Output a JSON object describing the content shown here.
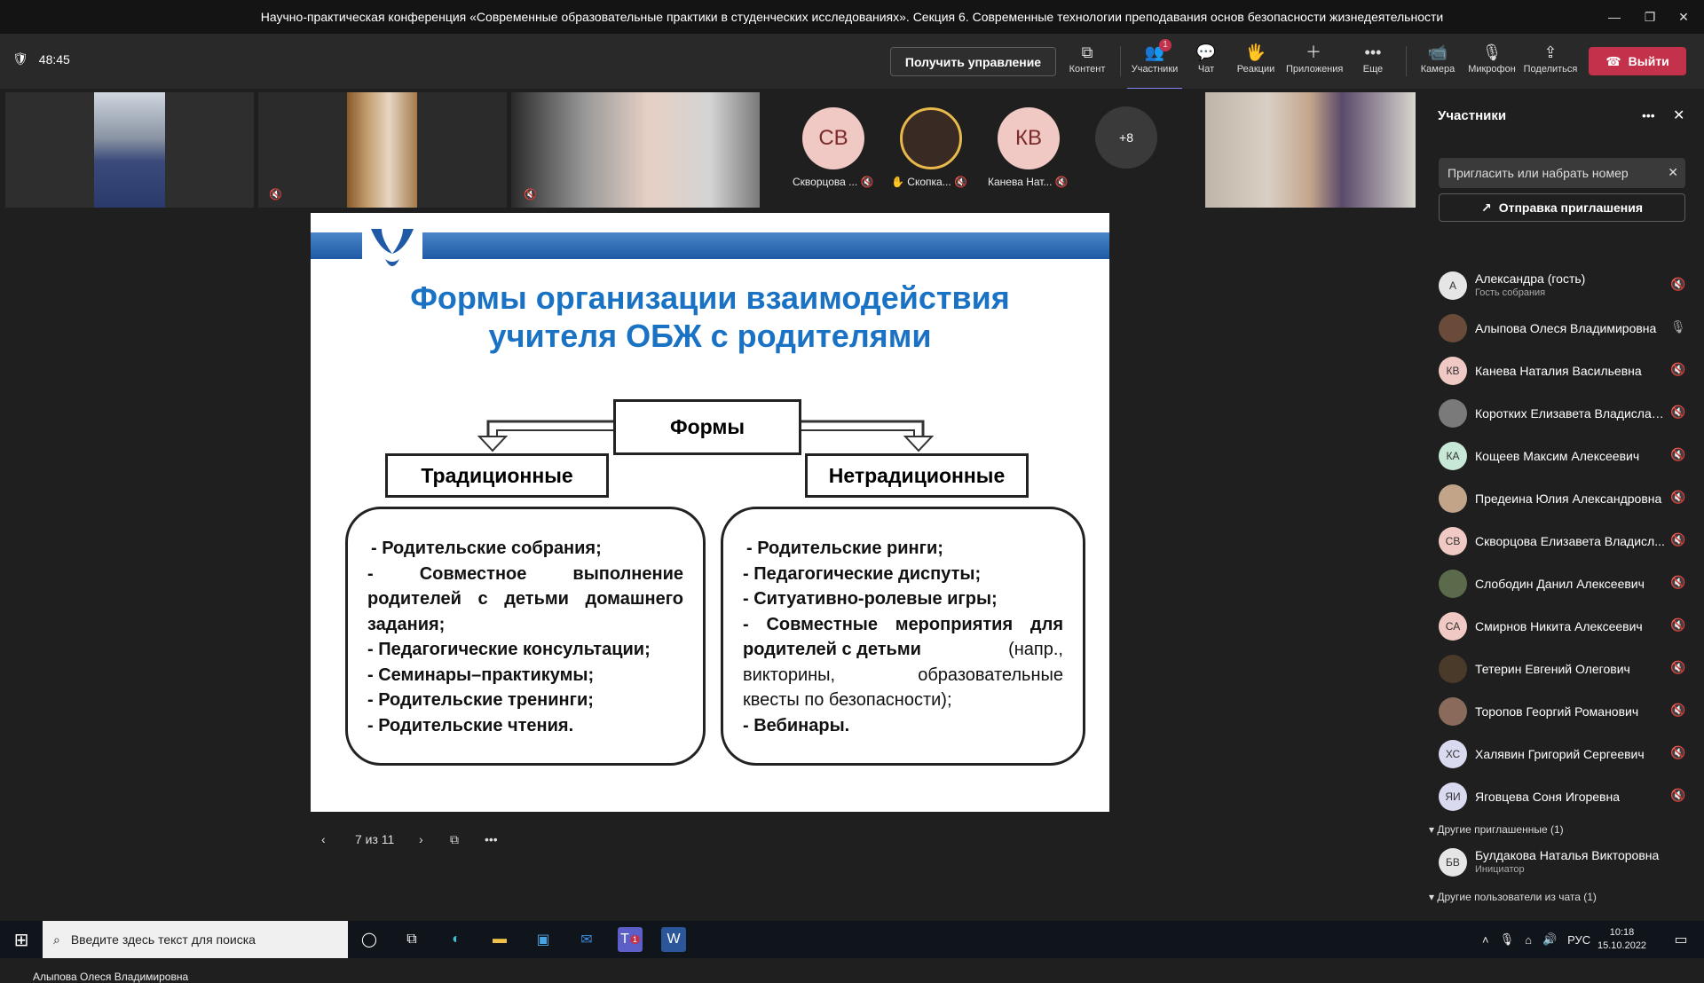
{
  "window": {
    "title": "Научно-практическая конференция «Современные образовательные практики в студенческих исследованиях». Секция 6. Современные технологии преподавания основ безопасности жизнедеятельности",
    "minimize": "—",
    "restore": "❐",
    "close": "✕"
  },
  "toolbar": {
    "timer": "48:45",
    "request_control": "Получить управление",
    "content": "Контент",
    "participants": "Участники",
    "participants_badge": "1",
    "chat": "Чат",
    "reactions": "Реакции",
    "apps": "Приложения",
    "more": "Еще",
    "camera": "Камера",
    "microphone": "Микрофон",
    "share": "Поделиться",
    "leave": "Выйти"
  },
  "gallery": {
    "tiles": [
      {
        "initials": "СВ",
        "label": "Скворцова ...",
        "color": "#f1c9c4"
      },
      {
        "initials": "",
        "label": "Скопка...",
        "color": "#3a2a24"
      },
      {
        "initials": "КВ",
        "label": "Канева Нат...",
        "color": "#f1c9c4"
      }
    ],
    "overflow": "+8",
    "hand_icon": "✋"
  },
  "slide": {
    "title_line1": "Формы организации взаимодействия",
    "title_line2": "учителя ОБЖ с родителями",
    "root": "Формы",
    "left_head": "Традиционные",
    "right_head": "Нетрадиционные",
    "left_items": [
      "- Родительские собрания;",
      "- Совместное выполнение",
      "родителей с детьми домашнего",
      "задания;",
      "- Педагогические консультации;",
      "- Семинары–практикумы;",
      "- Родительские тренинги;",
      "- Родительские чтения."
    ],
    "right_items": [
      "- Родительские ринги;",
      "- Педагогические диспуты;",
      "- Ситуативно-ролевые игры;",
      "- Совместные мероприятия для",
      "родителей с детьми",
      "(напр.,",
      "викторины, образовательные",
      "квесты по безопасности);",
      "- Вебинары."
    ]
  },
  "slide_nav": {
    "counter": "7 из 11"
  },
  "presenter": "Алыпова Олеся Владимировна",
  "panel": {
    "title": "Участники",
    "invite_placeholder": "Пригласить или набрать номер",
    "send_invite": "Отправка приглашения",
    "people": [
      {
        "initials": "А",
        "name": "Александра (гость)",
        "sub": "Гость собрания",
        "color": "#e6e6e6",
        "muted": true
      },
      {
        "initials": "",
        "name": "Алыпова Олеся Владимировна",
        "sub": "",
        "color": "#6a4b3a",
        "muted": false
      },
      {
        "initials": "КВ",
        "name": "Канева Наталия Васильевна",
        "sub": "",
        "color": "#f1c9c4",
        "muted": true
      },
      {
        "initials": "",
        "name": "Коротких Елизавета Владислав...",
        "sub": "",
        "color": "#7a7a7a",
        "muted": true
      },
      {
        "initials": "КА",
        "name": "Кощеев Максим Алексеевич",
        "sub": "",
        "color": "#c7e8d6",
        "muted": true
      },
      {
        "initials": "",
        "name": "Предеина Юлия Александровна",
        "sub": "",
        "color": "#c2a588",
        "muted": true
      },
      {
        "initials": "СВ",
        "name": "Скворцова Елизавета Владисл...",
        "sub": "",
        "color": "#f1c9c4",
        "muted": true
      },
      {
        "initials": "",
        "name": "Слободин Данил Алексеевич",
        "sub": "",
        "color": "#5a6a4a",
        "muted": true
      },
      {
        "initials": "СА",
        "name": "Смирнов Никита Алексеевич",
        "sub": "",
        "color": "#f1c9c4",
        "muted": true
      },
      {
        "initials": "",
        "name": "Тетерин Евгений Олегович",
        "sub": "",
        "color": "#4a3a2a",
        "muted": true
      },
      {
        "initials": "",
        "name": "Торопов Георгий Романович",
        "sub": "",
        "color": "#8a6a5a",
        "muted": true
      },
      {
        "initials": "ХС",
        "name": "Халявин Григорий Сергеевич",
        "sub": "",
        "color": "#d9d9ef",
        "muted": true
      },
      {
        "initials": "ЯИ",
        "name": "Яговцева Соня Игоревна",
        "sub": "",
        "color": "#d9d9ef",
        "muted": true
      }
    ],
    "section_other_invited": "Другие приглашенные (1)",
    "invited": {
      "initials": "БВ",
      "name": "Булдакова Наталья Викторовна",
      "sub": "Инициатор",
      "color": "#e6e6e6"
    },
    "section_chat_users": "Другие пользователи из чата (1)"
  },
  "taskbar": {
    "search_placeholder": "Введите здесь текст для поиска",
    "teams_badge": "1",
    "lang": "РУС",
    "time": "10:18",
    "date": "15.10.2022"
  }
}
